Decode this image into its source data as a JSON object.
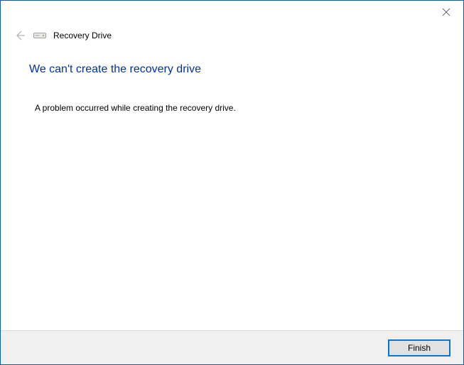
{
  "window": {
    "title": "Recovery Drive"
  },
  "heading": "We can't create the recovery drive",
  "message": "A problem occurred while creating the recovery drive.",
  "buttons": {
    "finish": "Finish"
  }
}
